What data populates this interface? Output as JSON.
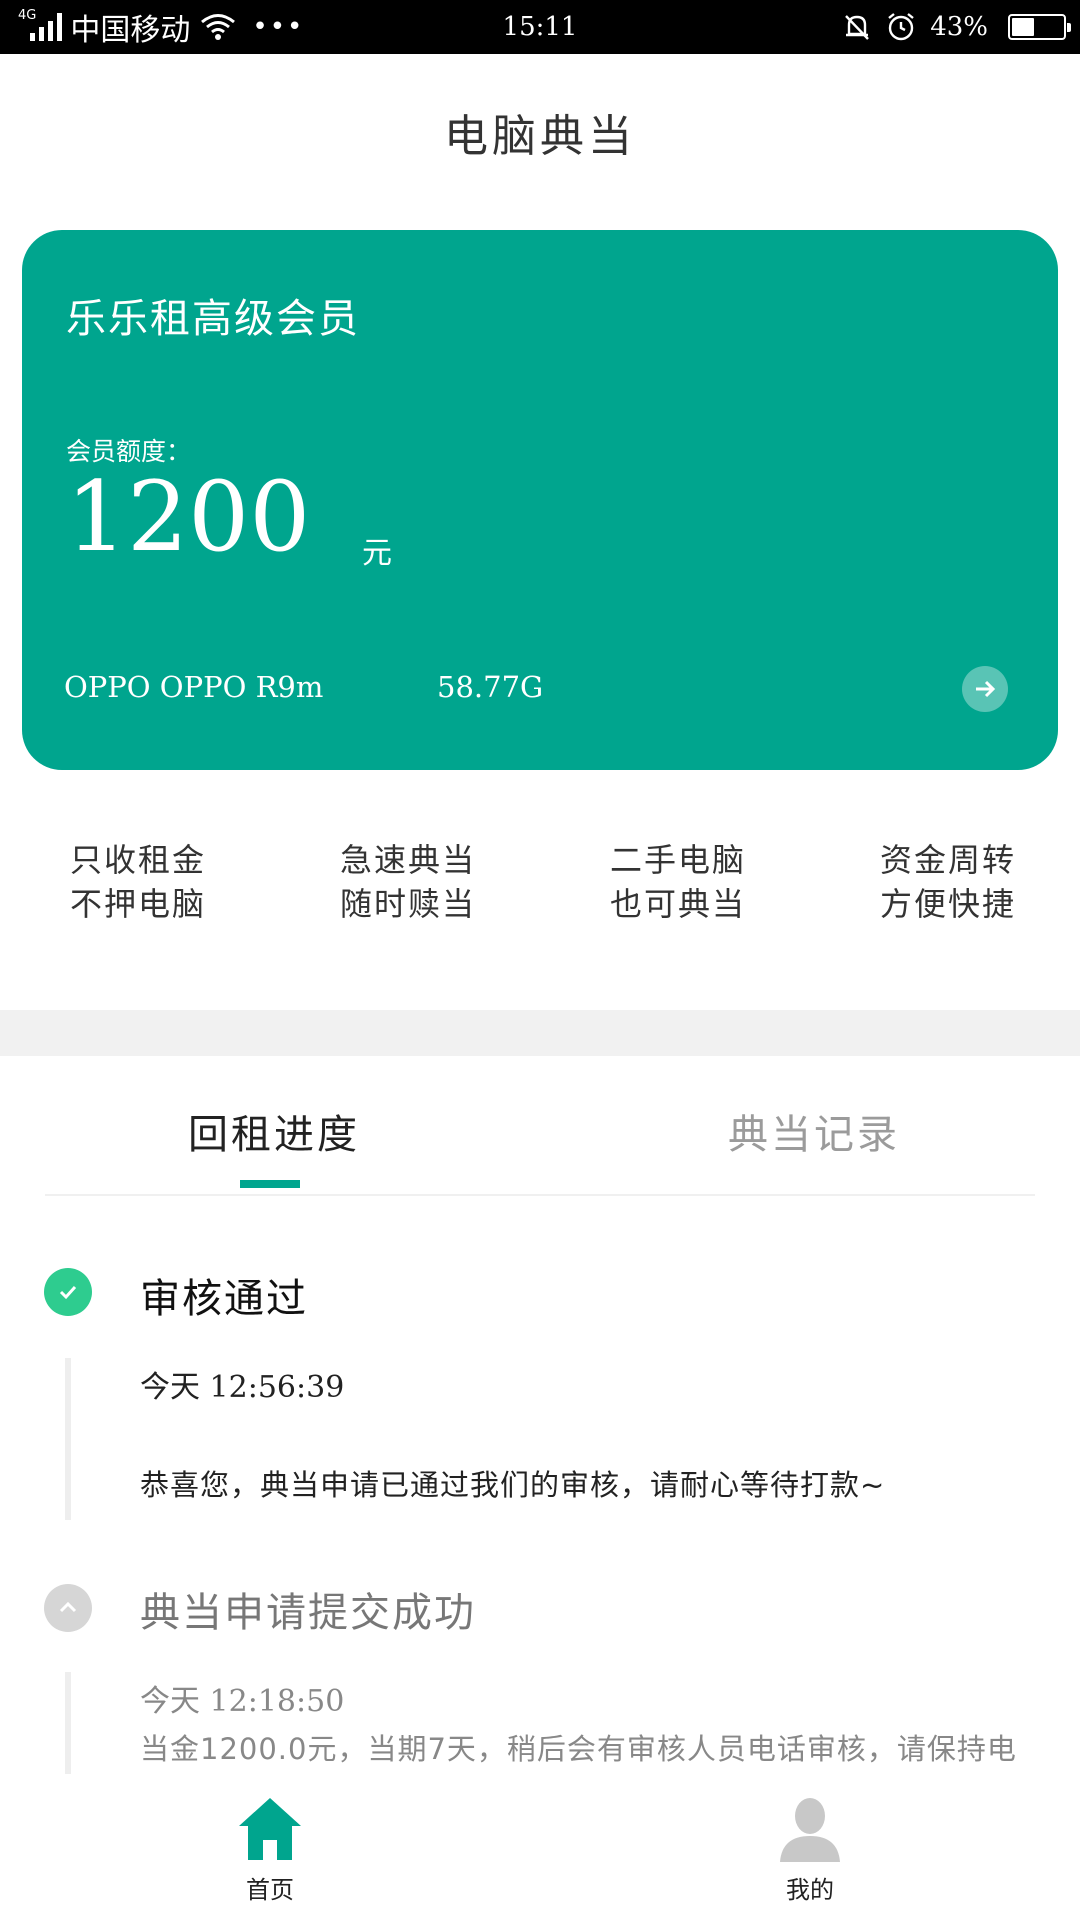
{
  "status_bar": {
    "network": "4G",
    "carrier": "中国移动",
    "more": "•••",
    "time": "15:11",
    "battery_percent": "43%",
    "battery_level": 0.43
  },
  "title": "电脑典当",
  "colors": {
    "brand": "#00A58E",
    "success": "#2ECC8F",
    "pending": "#d6d6d6"
  },
  "card": {
    "title": "乐乐租高级会员",
    "quota_label": "会员额度：",
    "quota_value": "1200",
    "quota_unit": "元",
    "device": "OPPO OPPO R9m",
    "storage": "58.77G"
  },
  "features": [
    {
      "line1": "只收租金",
      "line2": "不押电脑"
    },
    {
      "line1": "急速典当",
      "line2": "随时赎当"
    },
    {
      "line1": "二手电脑",
      "line2": "也可典当"
    },
    {
      "line1": "资金周转",
      "line2": "方便快捷"
    }
  ],
  "tabs": [
    {
      "label": "回租进度",
      "active": true
    },
    {
      "label": "典当记录",
      "active": false
    }
  ],
  "timeline": [
    {
      "title": "审核通过",
      "day": "今天",
      "time": "12:56:39",
      "message": "恭喜您，典当申请已通过我们的审核，请耐心等待打款~",
      "status": "done"
    },
    {
      "title": "典当申请提交成功",
      "day": "今天",
      "time": "12:18:50",
      "message": "当金1200.0元，当期7天，稍后会有审核人员电话审核，请保持电",
      "status": "pending"
    }
  ],
  "bottom_nav": [
    {
      "label": "首页",
      "icon": "home-icon",
      "active": true
    },
    {
      "label": "我的",
      "icon": "person-icon",
      "active": false
    }
  ]
}
